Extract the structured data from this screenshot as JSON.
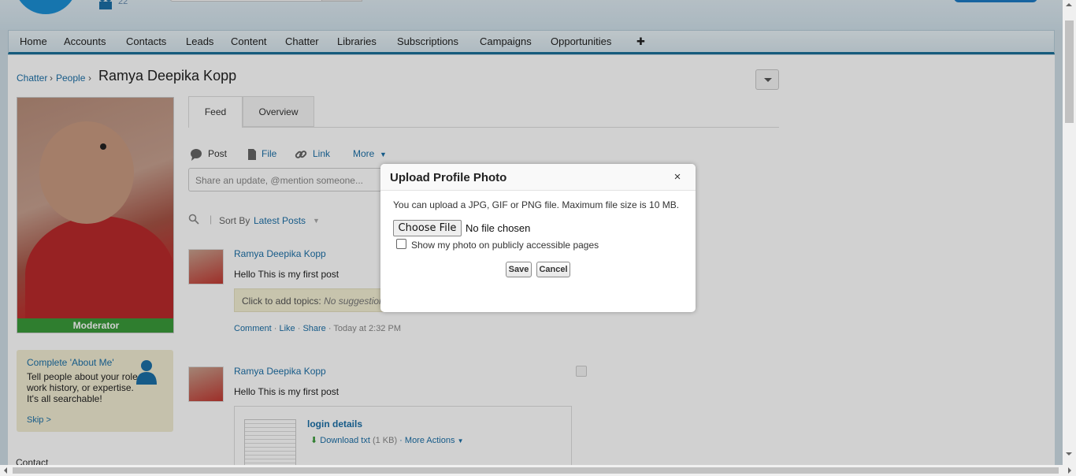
{
  "header": {
    "user_count": "22"
  },
  "nav": {
    "tabs": [
      "Home",
      "Accounts",
      "Contacts",
      "Leads",
      "Content",
      "Chatter",
      "Libraries",
      "Subscriptions",
      "Campaigns",
      "Opportunities"
    ],
    "plus_icon": "✚"
  },
  "breadcrumb": {
    "chatter": "Chatter",
    "people": "People",
    "separator": "›",
    "current": "Ramya Deepika Kopp"
  },
  "profile": {
    "badge": "Moderator",
    "about": {
      "title": "Complete 'About Me'",
      "text": "Tell people about your role, work history, or expertise. It's all searchable!",
      "skip": "Skip >"
    },
    "contact_label": "Contact"
  },
  "tabs": {
    "feed": "Feed",
    "overview": "Overview"
  },
  "publisher": {
    "post": "Post",
    "file": "File",
    "link": "Link",
    "more": "More",
    "placeholder": "Share an update, @mention someone..."
  },
  "sort": {
    "label": "Sort By",
    "value": "Latest Posts"
  },
  "posts": [
    {
      "author": "Ramya Deepika Kopp",
      "body": "Hello This is my first post",
      "topics_placeholder": "Click to add topics:",
      "topics_suggestions": "No suggestions",
      "actions": [
        "Comment",
        "Like",
        "Share"
      ],
      "time": "Today at 2:32 PM"
    },
    {
      "author": "Ramya Deepika Kopp",
      "body": "Hello This is my first post",
      "attachment": {
        "title": "login details",
        "download": "Download txt",
        "size": "(1 KB)",
        "more_actions": "More Actions"
      }
    }
  ],
  "modal": {
    "title": "Upload Profile Photo",
    "close": "×",
    "info": "You can upload a JPG, GIF or PNG file. Maximum file size is 10 MB.",
    "choose_file": "Choose File",
    "no_file": "No file chosen",
    "public_label": "Show my photo on publicly accessible pages",
    "public_checked": false,
    "save": "Save",
    "cancel": "Cancel"
  },
  "colors": {
    "link": "#1c6fa7",
    "nav_accent": "#1b6f98",
    "badge_green": "#3a9a3a"
  }
}
